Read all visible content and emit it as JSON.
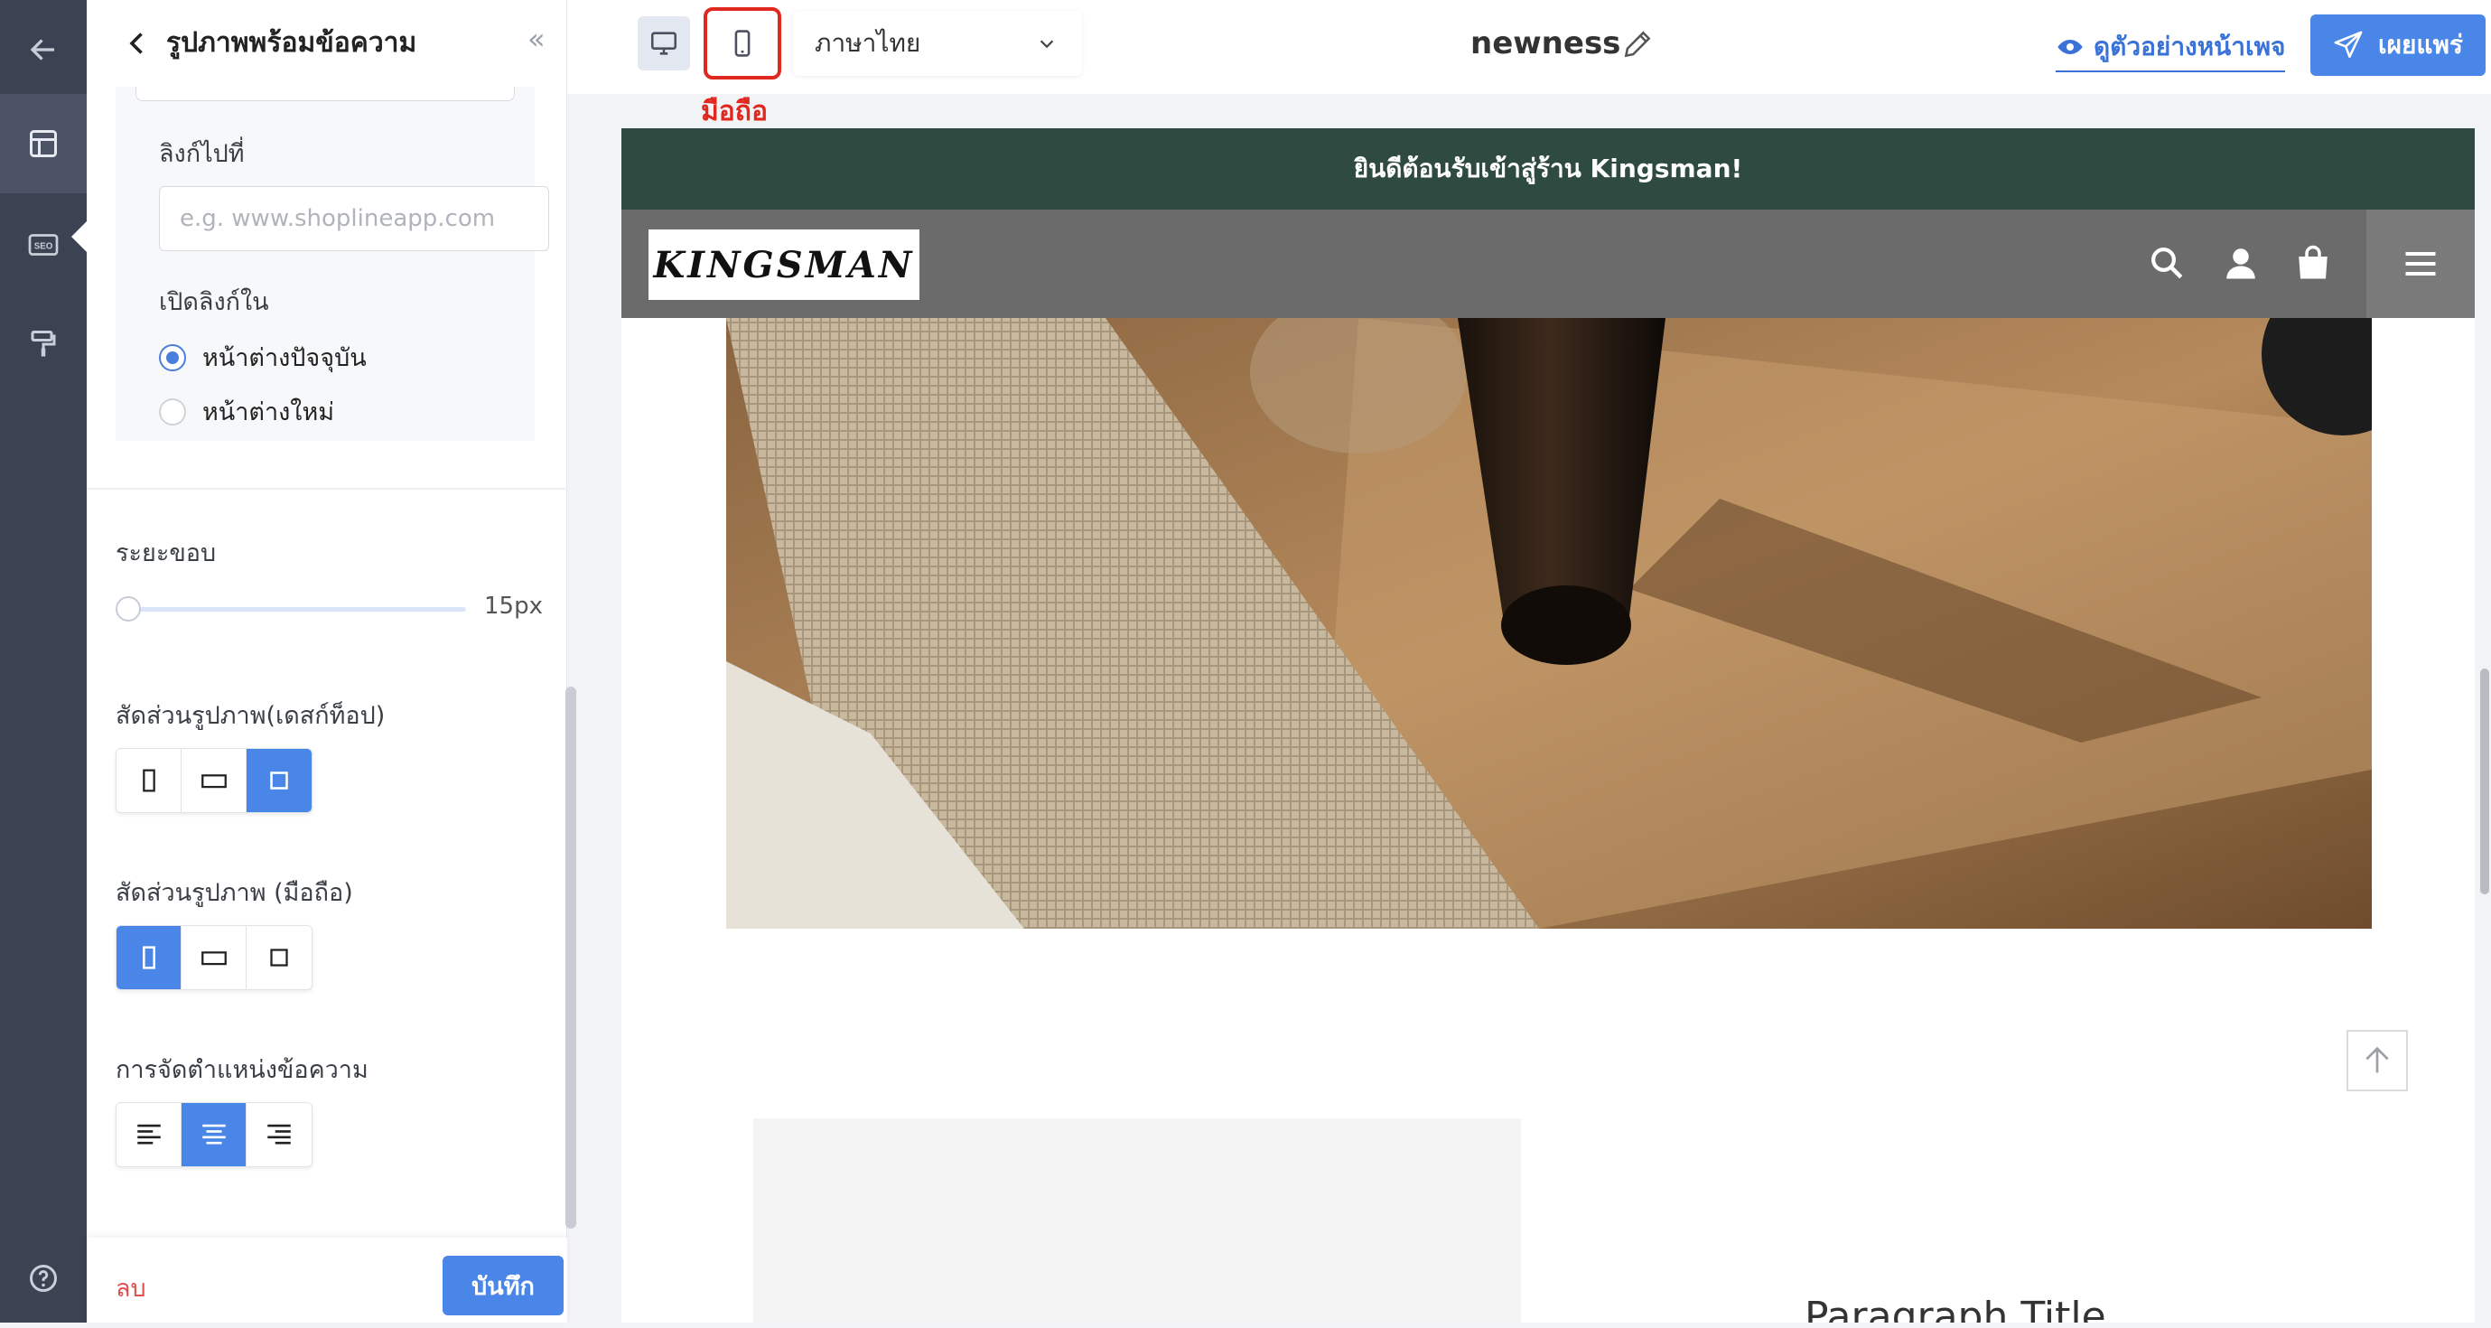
{
  "colors": {
    "accent": "#4a86e8",
    "rail": "#3b4252",
    "callout": "#e0281f",
    "announcement_bg": "#2f4a40",
    "delete": "#e05050"
  },
  "rail": {
    "items": [
      {
        "icon": "arrow-left-icon"
      },
      {
        "icon": "layout-icon",
        "active": true
      },
      {
        "icon": "seo-icon",
        "label": "SEO"
      },
      {
        "icon": "paint-roller-icon"
      },
      {
        "icon": "help-icon",
        "label": "?"
      }
    ]
  },
  "panel": {
    "title": "รูปภาพพร้อมข้อความ",
    "collapse_glyph": "«",
    "link_label": "ลิงก์ไปที่",
    "link_placeholder": "e.g. www.shoplineapp.com",
    "open_in_label": "เปิดลิงก์ใน",
    "open_options": [
      {
        "label": "หน้าต่างปัจจุบัน",
        "selected": true
      },
      {
        "label": "หน้าต่างใหม่",
        "selected": false
      }
    ],
    "margin_label": "ระยะขอบ",
    "margin_value": "15px",
    "desktop_ratio_label": "สัดส่วนรูปภาพ(เดสก์ท็อป)",
    "desktop_ratio_selected": "square",
    "mobile_ratio_label": "สัดส่วนรูปภาพ (มือถือ)",
    "mobile_ratio_selected": "portrait",
    "text_align_label": "การจัดตำแหน่งข้อความ",
    "text_align_selected": "center",
    "delete_label": "ลบ",
    "save_label": "บันทึก"
  },
  "toolbar": {
    "mobile_callout": "มือถือ",
    "language": "ภาษาไทย",
    "page_name": "newness",
    "preview_label": "ดูตัวอย่างหน้าเพจ",
    "publish_label": "เผยแพร่"
  },
  "preview": {
    "announcement": "ยินดีต้อนรับเข้าสู่ร้าน Kingsman!",
    "logo_text": "KINGSMAN",
    "paragraph_title": "Paragraph Title"
  }
}
